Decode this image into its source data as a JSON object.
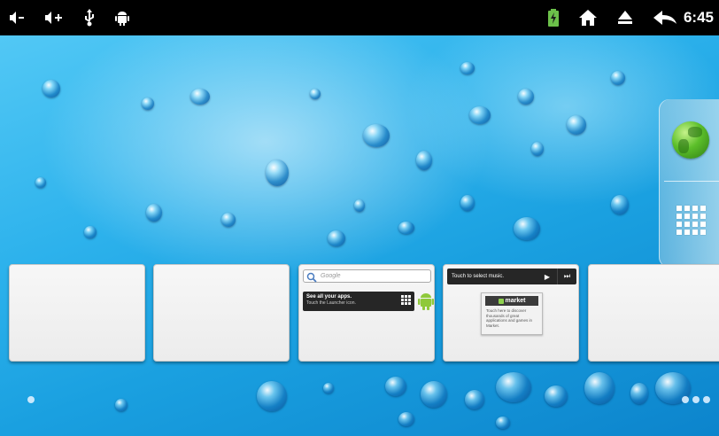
{
  "status_bar": {
    "left_icons": [
      "volume-down-icon",
      "volume-up-icon",
      "usb-icon",
      "android-debug-icon"
    ],
    "right_icons": [
      "battery-charging-icon",
      "home-icon",
      "eject-icon",
      "back-icon"
    ],
    "time": "6:45"
  },
  "home": {
    "wallpaper": "blue water droplets",
    "dock": {
      "items": [
        {
          "name": "browser-globe-icon"
        },
        {
          "name": "app-drawer-grid-icon"
        }
      ]
    },
    "panels": [
      {
        "index": 1,
        "widgets": []
      },
      {
        "index": 2,
        "widgets": []
      },
      {
        "index": 3,
        "search_placeholder": "Google",
        "apps_title": "See all your apps.",
        "apps_subtitle": "Touch the Launcher icon."
      },
      {
        "index": 4,
        "music_text": "Touch to select music.",
        "market_name": "market",
        "market_text": "Touch here to discover thousands of great applications and games in Market."
      },
      {
        "index": 5,
        "widgets": []
      }
    ],
    "page_indicators": {
      "left_count": 1,
      "right_count": 3
    }
  },
  "colors": {
    "status_bar": "#000000",
    "wallpaper_primary": "#1aa0e0",
    "panel_background": "#f2f2f2",
    "battery_accent": "#6cc04a"
  }
}
